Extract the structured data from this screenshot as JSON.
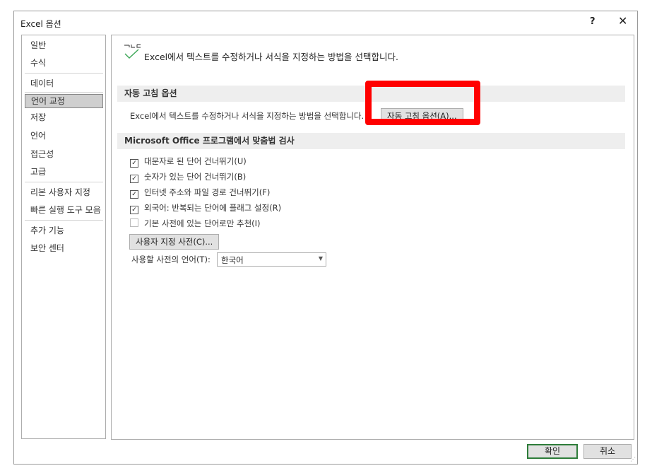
{
  "window": {
    "title": "Excel 옵션",
    "help_label": "?",
    "close_label": "✕"
  },
  "sidebar": {
    "items": [
      {
        "label": "일반"
      },
      {
        "label": "수식"
      },
      {
        "label": "데이터"
      },
      {
        "label": "언어 교정",
        "selected": true
      },
      {
        "label": "저장"
      },
      {
        "label": "언어"
      },
      {
        "label": "접근성"
      },
      {
        "label": "고급"
      },
      {
        "label": "리본 사용자 지정"
      },
      {
        "label": "빠른 실행 도구 모음"
      },
      {
        "label": "추가 기능"
      },
      {
        "label": "보안 센터"
      }
    ]
  },
  "content": {
    "header_text": "Excel에서 텍스트를 수정하거나 서식을 지정하는 방법을 선택합니다.",
    "header_icon": "abc-check-icon",
    "autocorrect": {
      "section_title": "자동 고침 옵션",
      "description": "Excel에서 텍스트를 수정하거나 서식을 지정하는 방법을 선택합니다.",
      "button_label": "자동 고침 옵션(A)..."
    },
    "spelling": {
      "section_title": "Microsoft Office 프로그램에서 맞춤법 검사",
      "options": [
        {
          "label": "대문자로 된 단어 건너뛰기(U)",
          "checked": true
        },
        {
          "label": "숫자가 있는 단어 건너뛰기(B)",
          "checked": true
        },
        {
          "label": "인터넷 주소와 파일 경로 건너뛰기(F)",
          "checked": true
        },
        {
          "label": "외국어: 반복되는 단어에 플래그 설정(R)",
          "checked": true
        },
        {
          "label": "기본 사전에 있는 단어로만 추천(I)",
          "checked": false
        }
      ],
      "custom_dict_button": "사용자 지정 사전(C)...",
      "dict_language_label": "사용할 사전의 언어(T):",
      "dict_language_value": "한국어"
    }
  },
  "footer": {
    "ok_label": "확인",
    "cancel_label": "취소"
  },
  "colors": {
    "highlight": "#ff0000",
    "ok_border": "#2e7d3a",
    "selected_item": "#cfcfcf",
    "section_bg": "#eeeeee"
  }
}
